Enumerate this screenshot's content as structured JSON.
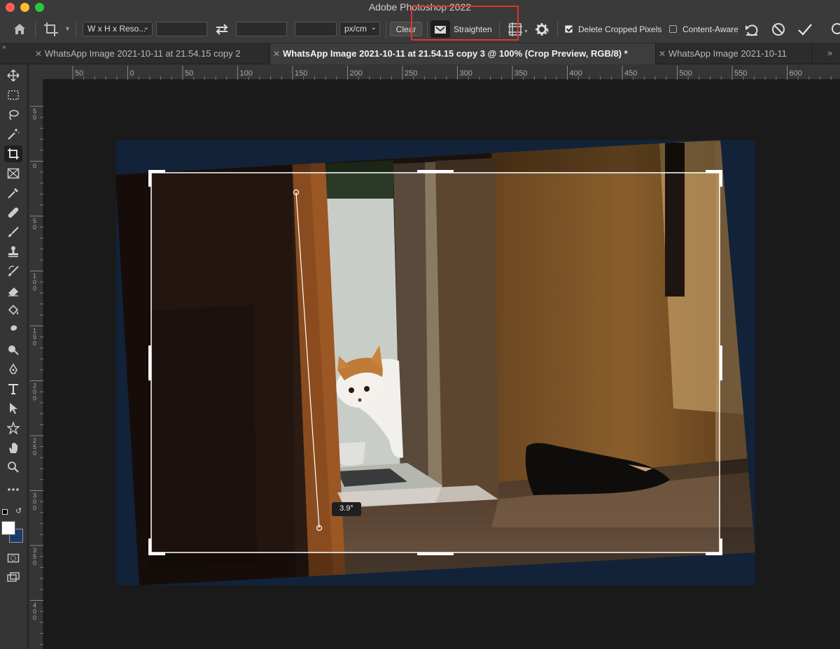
{
  "window": {
    "title": "Adobe Photoshop 2022"
  },
  "options_bar": {
    "ratio_preset": "W x H x Reso...",
    "unit": "px/cm",
    "clear_label": "Clear",
    "straighten_label": "Straighten",
    "delete_cropped_label": "Delete Cropped Pixels",
    "delete_cropped_checked": true,
    "content_aware_label": "Content-Aware",
    "content_aware_checked": false
  },
  "tabs": [
    {
      "label": "WhatsApp Image 2021-10-11 at 21.54.15 copy 2",
      "active": false
    },
    {
      "label": "WhatsApp Image 2021-10-11 at 21.54.15 copy 3 @ 100% (Crop Preview, RGB/8) *",
      "active": true
    },
    {
      "label": "WhatsApp Image 2021-10-11",
      "active": false
    }
  ],
  "ruler_top_labels": [
    "50",
    "0",
    "50",
    "100",
    "150",
    "200",
    "250",
    "300",
    "350",
    "400",
    "450",
    "500",
    "550",
    "600"
  ],
  "ruler_left_labels": [
    "50",
    "0",
    "50",
    "100",
    "150",
    "200",
    "250",
    "300",
    "350",
    "400"
  ],
  "straighten_angle": "3.9°",
  "icons": {
    "home": "home-icon",
    "crop": "crop-icon",
    "swap": "swap-arrows-icon",
    "straighten": "level-icon",
    "overlay": "grid-overlay-icon",
    "settings": "gear-icon",
    "reset": "undo-icon",
    "cancel": "cancel-icon",
    "commit": "checkmark-icon"
  },
  "colors": {
    "highlight": "#e0352b",
    "background_fill": "#1c3558",
    "foreground_swatch": "#ffffff",
    "background_swatch": "#1c3a6a"
  }
}
